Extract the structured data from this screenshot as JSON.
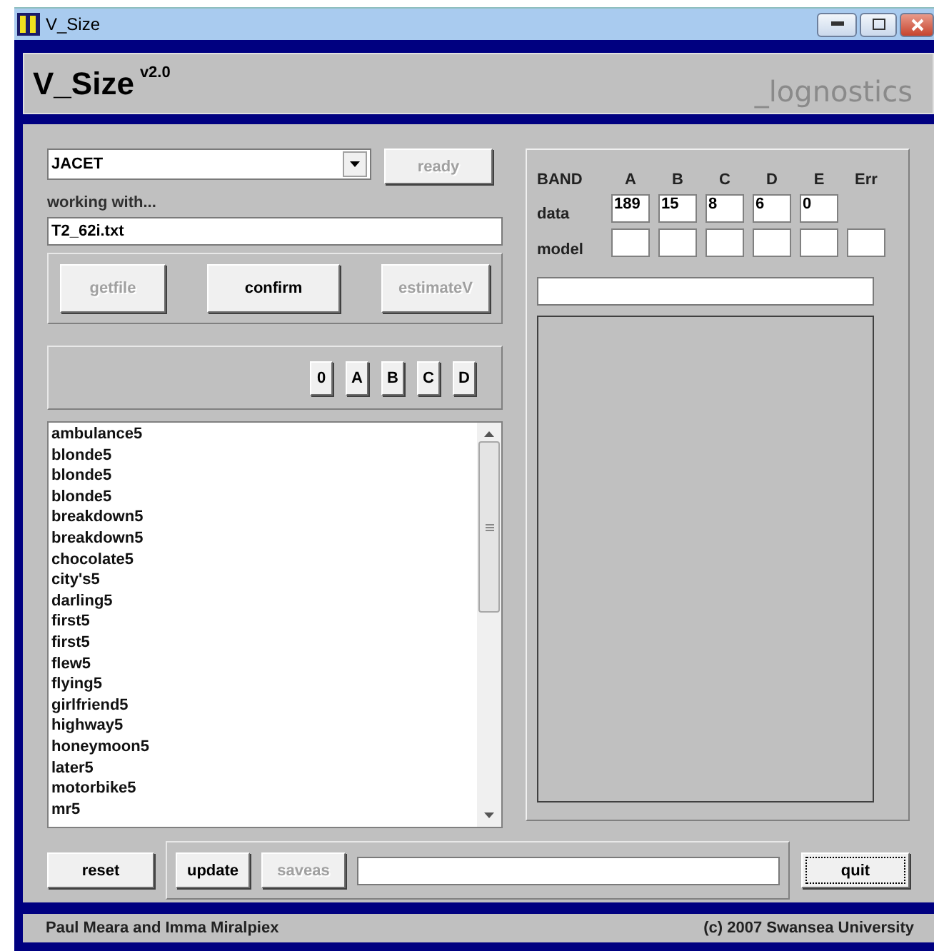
{
  "window": {
    "title": "V_Size"
  },
  "header": {
    "title": "V_Size",
    "version": "v2.0",
    "logo": "_lognostics"
  },
  "list_dropdown": {
    "value": "JACET"
  },
  "ready_button": {
    "label": "ready",
    "disabled": true
  },
  "working_label": "working with...",
  "file_field": {
    "value": "T2_62i.txt"
  },
  "action_buttons": [
    {
      "label": "getfile",
      "disabled": true
    },
    {
      "label": "confirm",
      "disabled": false
    },
    {
      "label": "estimateV",
      "disabled": true
    }
  ],
  "band_buttons": [
    "0",
    "A",
    "B",
    "C",
    "D"
  ],
  "words": [
    "ambulance5",
    "blonde5",
    "blonde5",
    "blonde5",
    "breakdown5",
    "breakdown5",
    "chocolate5",
    "city's5",
    "darling5",
    "first5",
    "first5",
    "flew5",
    "flying5",
    "girlfriend5",
    "highway5",
    "honeymoon5",
    "later5",
    "motorbike5",
    "mr5"
  ],
  "band_table": {
    "header": "BAND",
    "columns": [
      "A",
      "B",
      "C",
      "D",
      "E",
      "Err"
    ],
    "data_label": "data",
    "data": [
      "189",
      "15",
      "8",
      "6",
      "0"
    ],
    "model_label": "model"
  },
  "bottom": {
    "reset": {
      "label": "reset",
      "disabled": false
    },
    "update": {
      "label": "update",
      "disabled": false
    },
    "saveas": {
      "label": "saveas",
      "disabled": true
    },
    "quit": {
      "label": "quit",
      "disabled": false,
      "focused": true
    }
  },
  "status_bar": {
    "left": "Paul Meara and Imma Miralpiex",
    "right": "(c) 2007 Swansea University"
  }
}
